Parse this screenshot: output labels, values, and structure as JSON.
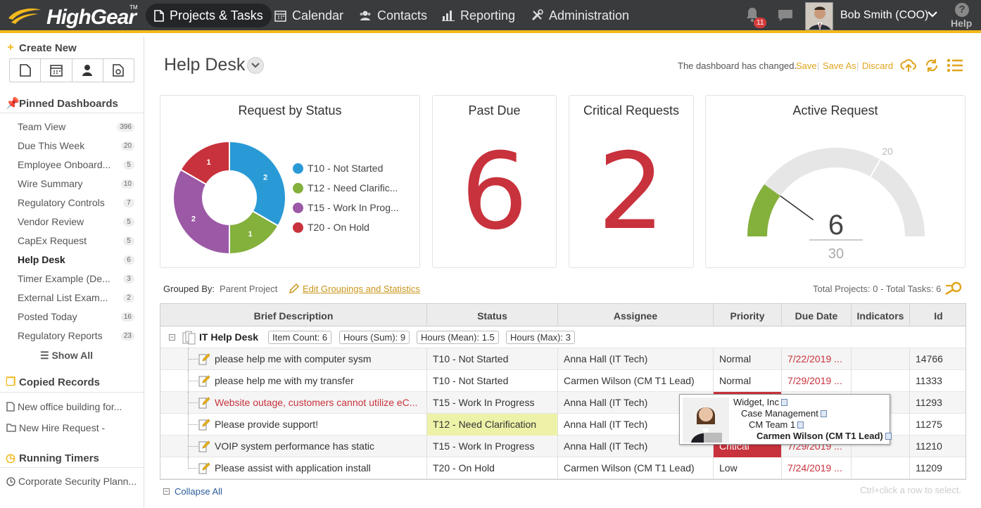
{
  "app": {
    "logo_text": "HighGear",
    "logo_tm": "TM"
  },
  "nav": {
    "items": [
      {
        "label": "Projects & Tasks",
        "icon": "document-icon",
        "active": true
      },
      {
        "label": "Calendar",
        "icon": "calendar-icon"
      },
      {
        "label": "Contacts",
        "icon": "contacts-icon"
      },
      {
        "label": "Reporting",
        "icon": "bar-chart-icon"
      },
      {
        "label": "Administration",
        "icon": "tools-icon"
      }
    ],
    "notifications_count": "11",
    "user_name": "Bob Smith (COO)",
    "help_label": "Help",
    "accent": "#f2b91c"
  },
  "sidebar": {
    "create_new": "Create New",
    "pinned_title": "Pinned Dashboards",
    "pinned": [
      {
        "label": "Team View",
        "count": "396"
      },
      {
        "label": "Due This Week",
        "count": "20"
      },
      {
        "label": "Employee Onboard...",
        "count": "5"
      },
      {
        "label": "Wire Summary",
        "count": "10"
      },
      {
        "label": "Regulatory Controls",
        "count": "7"
      },
      {
        "label": "Vendor Review",
        "count": "5"
      },
      {
        "label": "CapEx Request",
        "count": "5"
      },
      {
        "label": "Help Desk",
        "count": "6"
      },
      {
        "label": "Timer Example (De...",
        "count": "3"
      },
      {
        "label": "External List Exam...",
        "count": "2"
      },
      {
        "label": "Posted Today",
        "count": "16"
      },
      {
        "label": "Regulatory Reports",
        "count": "23"
      }
    ],
    "show_all": "Show All",
    "copied_title": "Copied Records",
    "copied": [
      {
        "label": "New office building for..."
      },
      {
        "label": "New Hire Request -"
      }
    ],
    "timers_title": "Running Timers",
    "timers": [
      {
        "label": "Corporate Security Plann..."
      }
    ]
  },
  "header": {
    "title": "Help Desk",
    "changed_msg": "The dashboard has changed.",
    "save": "Save",
    "save_as": "Save As",
    "discard": "Discard"
  },
  "widgets": {
    "status_title": "Request by Status",
    "past_due_title": "Past Due",
    "past_due_value": "6",
    "critical_title": "Critical Requests",
    "critical_value": "2",
    "active_title": "Active Request",
    "active_value": "6",
    "active_max": "30",
    "active_threshold": "20"
  },
  "chart_data": {
    "type": "pie",
    "title": "Request by Status",
    "donut": true,
    "categories": [
      "T10 - Not Started",
      "T12 - Need Clarific...",
      "T15 - Work In Prog...",
      "T20 - On Hold"
    ],
    "values": [
      2,
      1,
      2,
      1
    ],
    "colors": [
      "#2a9ad6",
      "#84b03c",
      "#9b59a6",
      "#c8323c"
    ],
    "legend": "right"
  },
  "gauge": {
    "min": 0,
    "max": 30,
    "value": 6,
    "threshold": 20,
    "fill_color": "#84b03c",
    "track_color": "#e6e6e6"
  },
  "grouping": {
    "label": "Grouped By:",
    "value": "Parent Project",
    "edit_link": "Edit Groupings and Statistics",
    "totals": "Total Projects: 0 - Total Tasks: 6"
  },
  "table": {
    "columns": [
      "Brief Description",
      "Status",
      "Assignee",
      "Priority",
      "Due Date",
      "Indicators",
      "Id"
    ],
    "group": {
      "name": "IT Help Desk",
      "stats": [
        {
          "label": "Item Count:",
          "value": "6"
        },
        {
          "label": "Hours (Sum):",
          "value": "9"
        },
        {
          "label": "Hours (Mean):",
          "value": "1.5"
        },
        {
          "label": "Hours (Max):",
          "value": "3"
        }
      ]
    },
    "rows": [
      {
        "desc": "please help me with computer sysm",
        "status": "T10 - Not Started",
        "assignee": "Anna Hall (IT Tech)",
        "priority": "Normal",
        "due": "7/22/2019 ...",
        "id": "14766"
      },
      {
        "desc": "please help me with my transfer",
        "status": "T10 - Not Started",
        "assignee": "Carmen Wilson (CM T1 Lead)",
        "priority": "Normal",
        "due": "7/29/2019 ...",
        "id": "11333"
      },
      {
        "desc": "Website outage, customers cannot utilize eC...",
        "status": "T15 - Work In Progress",
        "assignee": "Anna Hall (IT Tech)",
        "priority": "",
        "due": "",
        "id": "11293"
      },
      {
        "desc": "Please provide support!",
        "status": "T12 - Need Clarification",
        "assignee": "Anna Hall (IT Tech)",
        "priority": "",
        "due": "",
        "id": "11275"
      },
      {
        "desc": "VOIP system performance has static",
        "status": "T15 - Work In Progress",
        "assignee": "Anna Hall (IT Tech)",
        "priority": "Critical",
        "due": "7/29/2019 ...",
        "id": "11210"
      },
      {
        "desc": "Please assist with application install",
        "status": "T20 - On Hold",
        "assignee": "Carmen Wilson (CM T1 Lead)",
        "priority": "Low",
        "due": "7/24/2019 ...",
        "id": "11209"
      }
    ]
  },
  "popup": {
    "company": "Widget, Inc",
    "department": "Case Management",
    "team": "CM Team 1",
    "person": "Carmen Wilson (CM T1 Lead)"
  },
  "footer": {
    "collapse_all": "Collapse All",
    "hint": "Ctrl+click a row to select."
  }
}
